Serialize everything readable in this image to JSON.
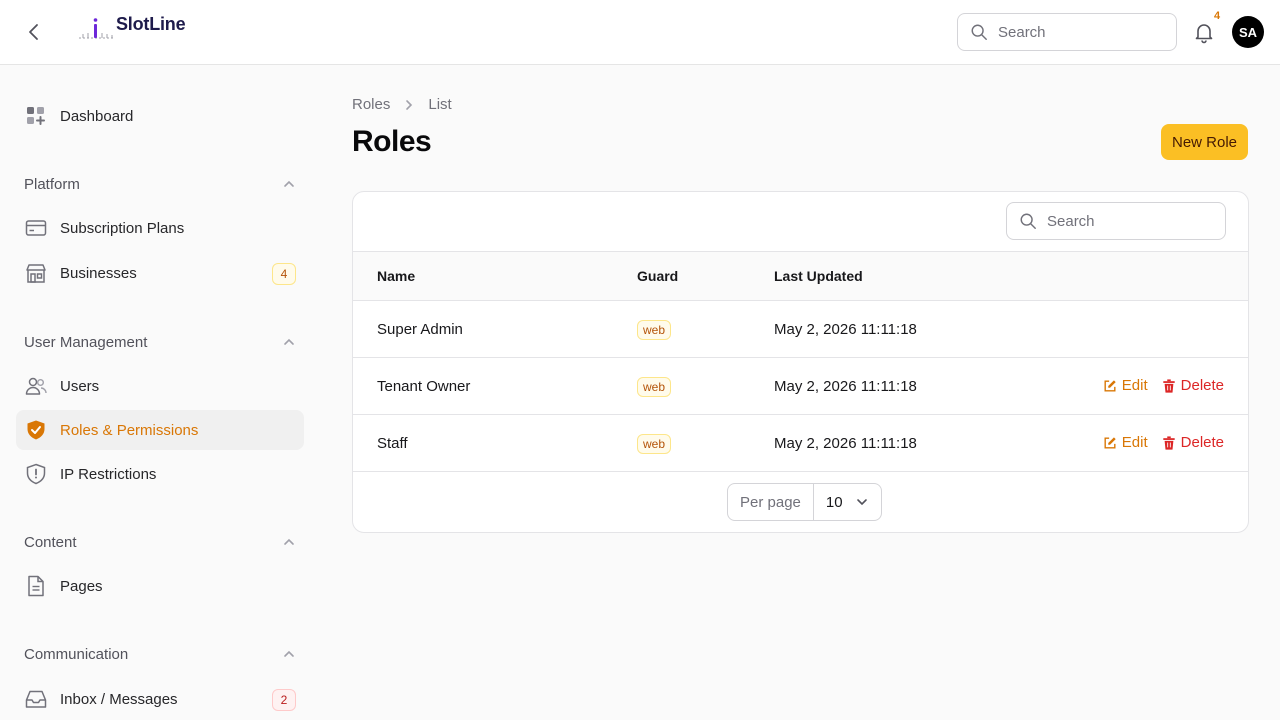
{
  "topbar": {
    "brand": "SlotLine",
    "search_placeholder": "Search",
    "notification_count": "4",
    "avatar_initials": "SA"
  },
  "sidebar": {
    "dashboard": "Dashboard",
    "groups": {
      "platform": "Platform",
      "user_management": "User Management",
      "content": "Content",
      "communication": "Communication"
    },
    "items": {
      "subscription_plans": "Subscription Plans",
      "businesses": "Businesses",
      "businesses_badge": "4",
      "users": "Users",
      "roles": "Roles & Permissions",
      "ip_restrictions": "IP Restrictions",
      "pages": "Pages",
      "inbox": "Inbox / Messages",
      "inbox_badge": "2"
    },
    "active_color": "#d97706"
  },
  "main": {
    "breadcrumb": [
      "Roles",
      "List"
    ],
    "title": "Roles",
    "new_button": "New Role",
    "table": {
      "search_placeholder": "Search",
      "columns": [
        "Name",
        "Guard",
        "Last Updated"
      ],
      "rows": [
        {
          "name": "Super Admin",
          "guard": "web",
          "updated": "May 2, 2026 11:11:18",
          "editable": false
        },
        {
          "name": "Tenant Owner",
          "guard": "web",
          "updated": "May 2, 2026 11:11:18",
          "editable": true
        },
        {
          "name": "Staff",
          "guard": "web",
          "updated": "May 2, 2026 11:11:18",
          "editable": true
        }
      ],
      "edit_label": "Edit",
      "delete_label": "Delete",
      "per_page_label": "Per page",
      "per_page_value": "10"
    }
  },
  "colors": {
    "accent": "#fbbf24",
    "edit": "#d97706",
    "delete": "#dc2626"
  }
}
